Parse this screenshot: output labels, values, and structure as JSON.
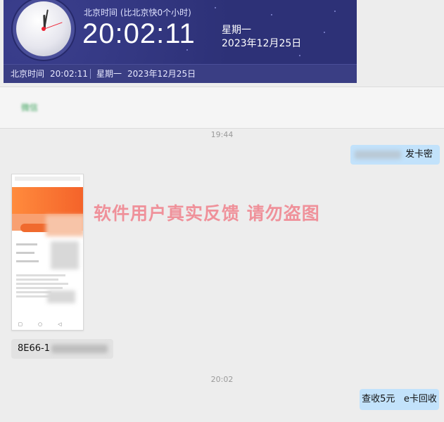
{
  "clock": {
    "label": "北京时间 (比北京快0个小时)",
    "time": "20:02:11",
    "weekday": "星期一",
    "date": "2023年12月25日",
    "footer_label": "北京时间",
    "footer_time": "20:02:11",
    "footer_weekday": "星期一",
    "footer_date": "2023年12月25日"
  },
  "chat": {
    "title": "微信",
    "messages": [
      {
        "type": "time",
        "text": "19:44"
      },
      {
        "type": "text",
        "side": "right",
        "text": "发卡密"
      },
      {
        "type": "image",
        "side": "left",
        "description": "screenshot"
      },
      {
        "type": "text",
        "side": "left",
        "text": "8E66-1"
      },
      {
        "type": "time",
        "text": "20:02"
      },
      {
        "type": "text",
        "side": "right",
        "text": "查收5元   e卡回收"
      }
    ]
  },
  "watermark": "软件用户真实反馈  请勿盗图",
  "colors": {
    "clock_bg": "#2d3177",
    "bubble_right": "#c2e2fb",
    "bubble_left": "#e2e2e2",
    "watermark": "#f08a93"
  }
}
